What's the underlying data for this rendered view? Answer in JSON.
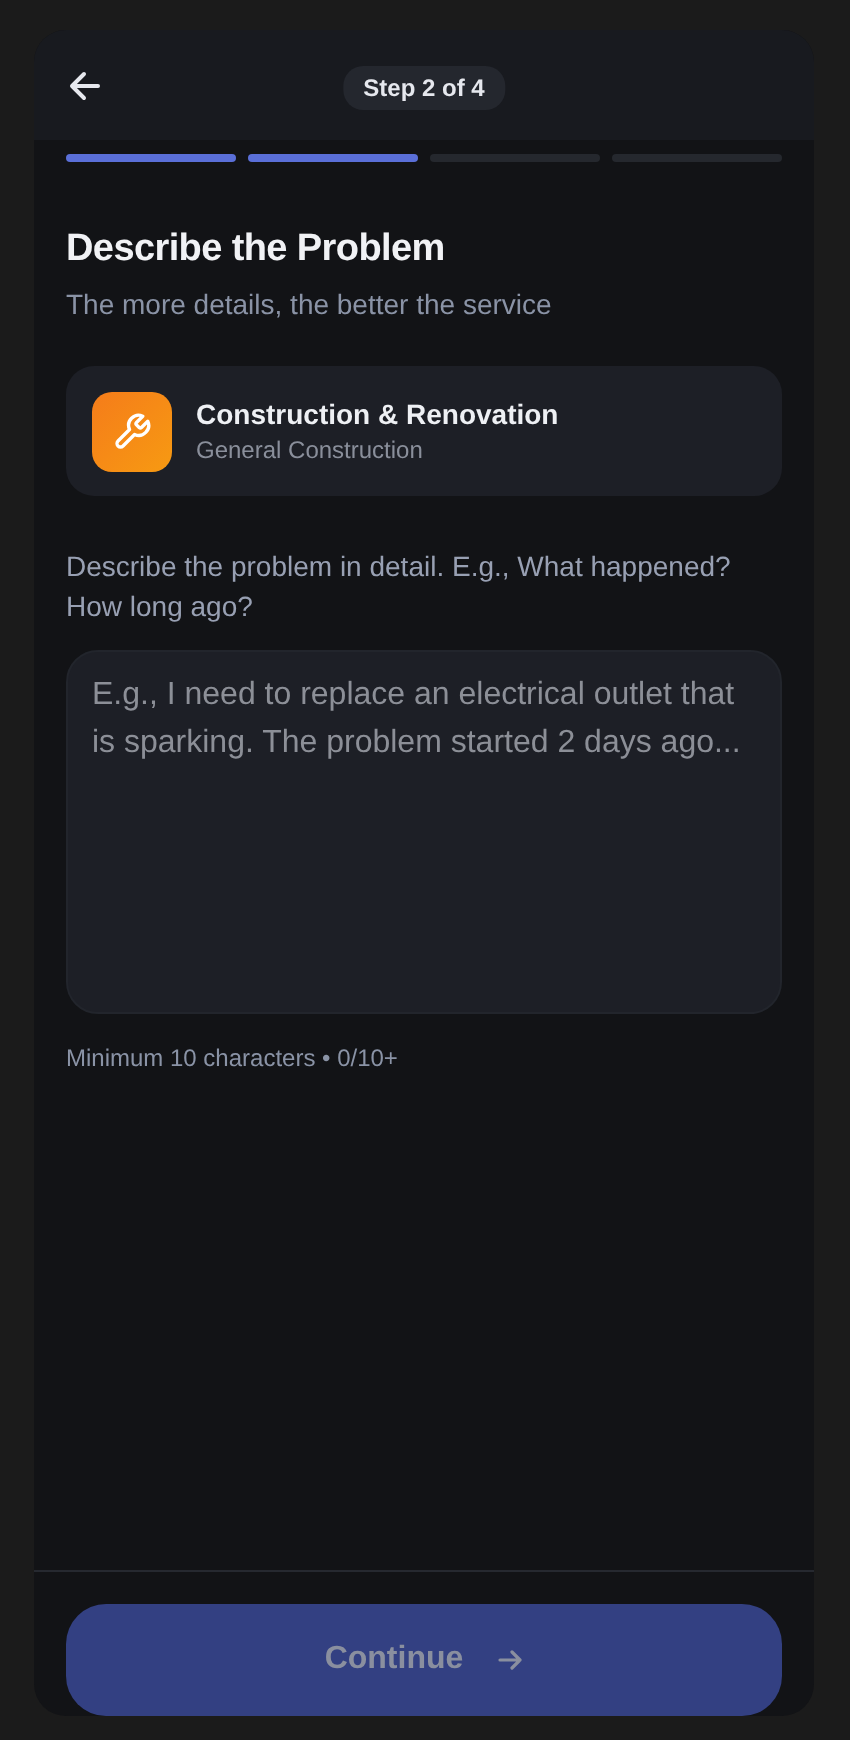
{
  "header": {
    "step_label": "Step 2 of 4"
  },
  "progress": [
    {
      "done": true
    },
    {
      "done": true
    },
    {
      "done": false
    },
    {
      "done": false
    }
  ],
  "title": "Describe the Problem",
  "subtitle": "The more details, the better the service",
  "category": {
    "name": "Construction & Renovation",
    "subcategory": "General Construction"
  },
  "description": {
    "label": "Describe the problem in detail. E.g., What happened? How long ago?",
    "placeholder": "E.g., I need to replace an electrical outlet that is sparking. The problem started 2 days ago...",
    "hint": "Minimum 10 characters • 0/10+"
  },
  "continue_button": {
    "label": "Continue",
    "disabled": true
  }
}
